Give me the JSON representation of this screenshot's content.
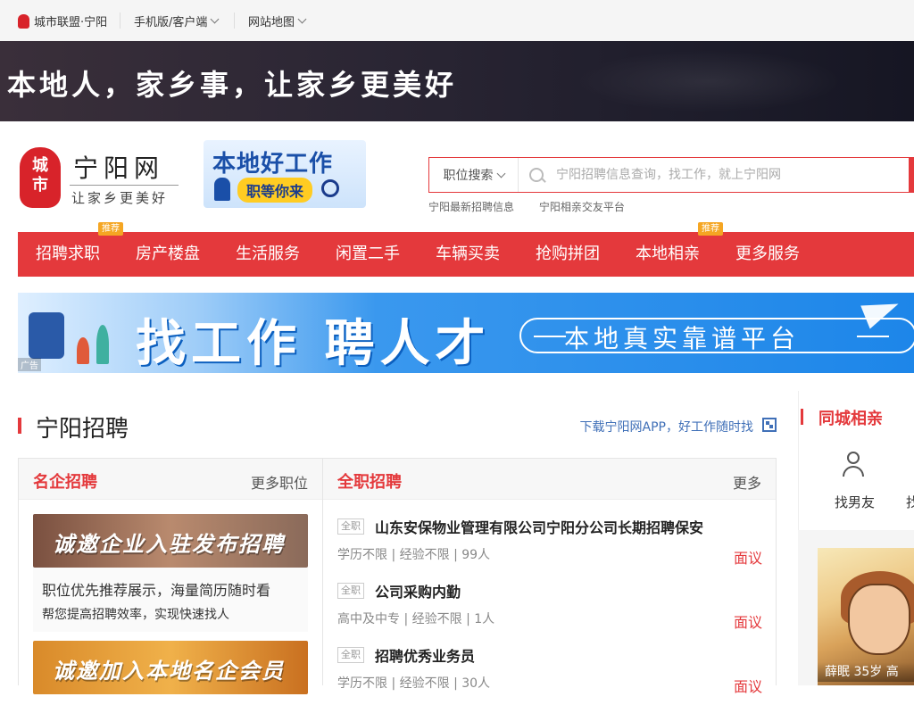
{
  "topbar": {
    "city": "城市联盟·宁阳",
    "mobile": "手机版/客户端",
    "sitemap": "网站地图"
  },
  "hero": {
    "slogan": "本地人，家乡事，让家乡更美好"
  },
  "logo": {
    "seal_top": "城",
    "seal_bottom": "市",
    "site_name": "宁阳网",
    "motto": "让家乡更美好"
  },
  "job_badge": {
    "title": "本地好工作",
    "subtitle": "职等你来"
  },
  "search": {
    "category": "职位搜索",
    "placeholder": "宁阳招聘信息查询，找工作，就上宁阳网",
    "hot_links": [
      "宁阳最新招聘信息",
      "宁阳相亲交友平台"
    ]
  },
  "nav": {
    "items": [
      "招聘求职",
      "房产楼盘",
      "生活服务",
      "闲置二手",
      "车辆买卖",
      "抢购拼团",
      "本地相亲",
      "更多服务"
    ],
    "tag": "推荐"
  },
  "ad": {
    "title": "找工作 聘人才",
    "subtitle": "本地真实靠谱平台",
    "label": "广告"
  },
  "section": {
    "title": "宁阳招聘",
    "download": "下载宁阳网APP，好工作随时找"
  },
  "famous": {
    "title": "名企招聘",
    "more": "更多职位",
    "promos": [
      {
        "banner": "诚邀企业入驻发布招聘",
        "line1": "职位优先推荐展示，海量简历随时看",
        "line2": "帮您提高招聘效率，实现快速找人"
      },
      {
        "banner": "诚邀加入本地名企会员"
      }
    ]
  },
  "fulltime": {
    "title": "全职招聘",
    "more": "更多",
    "badge": "全职",
    "jobs": [
      {
        "title": "山东安保物业管理有限公司宁阳分公司长期招聘保安",
        "meta": "学历不限 | 经验不限 | 99人",
        "salary": "面议"
      },
      {
        "title": "公司采购内勤",
        "meta": "高中及中专 | 经验不限 | 1人",
        "salary": "面议"
      },
      {
        "title": "招聘优秀业务员",
        "meta": "学历不限 | 经验不限 | 30人",
        "salary": "面议"
      }
    ]
  },
  "dating": {
    "title": "同城相亲",
    "actions": [
      "找男友",
      "找"
    ],
    "photo_caption": "薛眠 35岁 高"
  },
  "colors": {
    "brand_red": "#e4393c",
    "tag_orange": "#f5a623",
    "link_blue": "#3f6fb7"
  }
}
